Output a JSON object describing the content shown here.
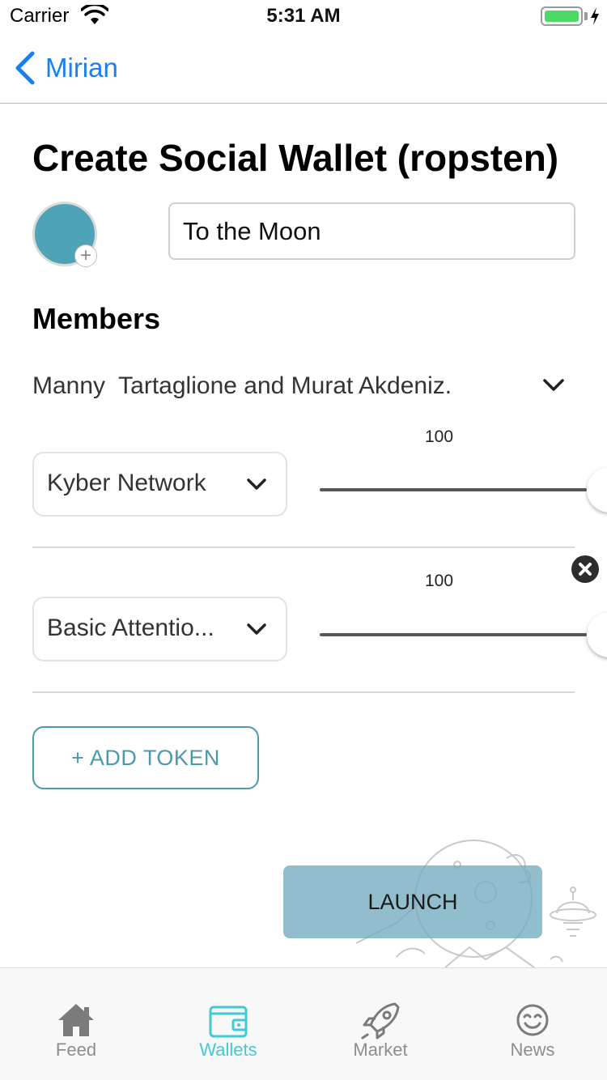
{
  "status_bar": {
    "carrier": "Carrier",
    "time": "5:31 AM",
    "battery_level": 1.0
  },
  "nav": {
    "back_label": "Mirian"
  },
  "page": {
    "title": "Create Social Wallet (ropsten)"
  },
  "wallet_name": {
    "value": "To the Moon"
  },
  "members": {
    "heading": "Members",
    "summary": "Manny  Tartaglione and Murat Akdeniz."
  },
  "tokens": [
    {
      "label": "Kyber Network",
      "value": "100"
    },
    {
      "label": "Basic Attentio...",
      "value": "100"
    }
  ],
  "add_token_label": "+ ADD TOKEN",
  "launch_label": "LAUNCH",
  "tab_bar": {
    "items": [
      {
        "label": "Feed",
        "icon": "home-icon"
      },
      {
        "label": "Wallets",
        "icon": "wallet-icon",
        "active": true
      },
      {
        "label": "Market",
        "icon": "rocket-icon"
      },
      {
        "label": "News",
        "icon": "smiley-icon"
      }
    ]
  },
  "colors": {
    "accent": "#1a80f0",
    "teal": "#4a9aaa",
    "active_tab": "#40c9d6",
    "avatar": "#4fa3b7",
    "launch": "#76adc0"
  }
}
